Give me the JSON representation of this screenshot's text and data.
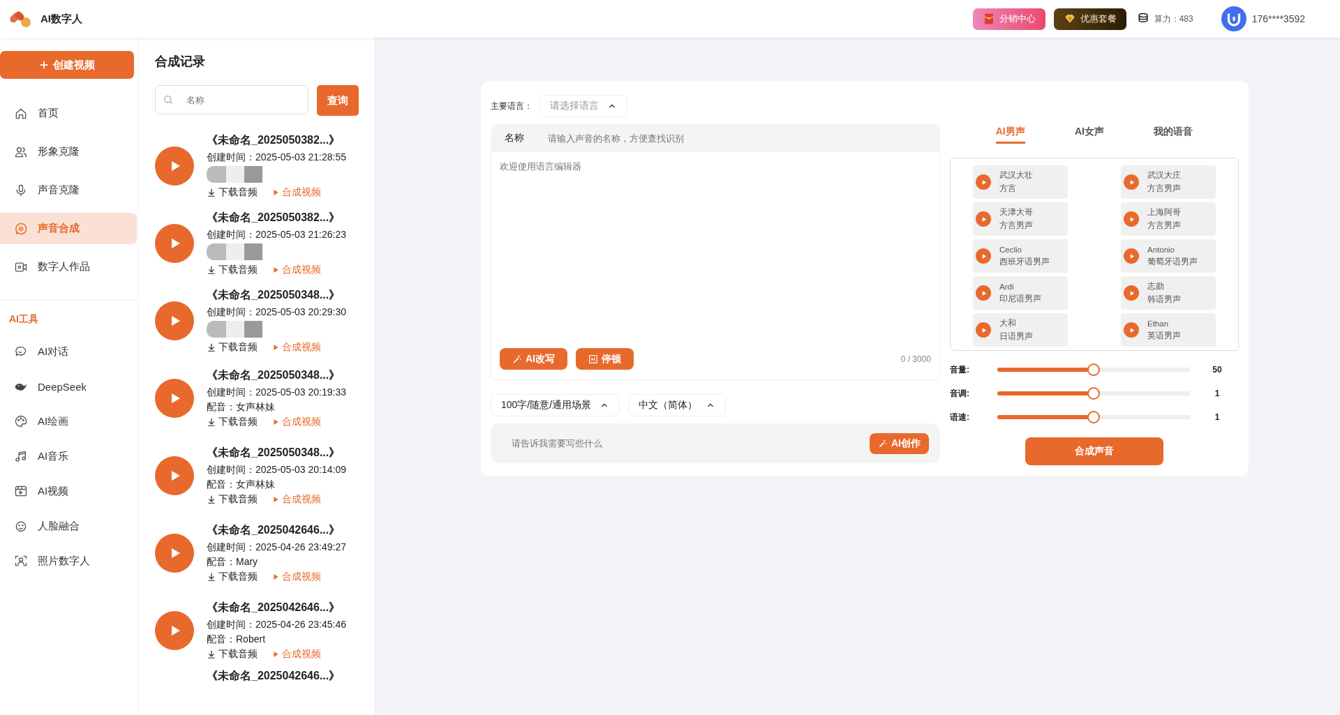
{
  "header": {
    "app_name": "AI数字人",
    "buttons": [
      {
        "kind": "distribution",
        "label": "分销中心"
      },
      {
        "kind": "package",
        "label": "优惠套餐"
      }
    ],
    "credits": "算力：483",
    "user": "176****3592"
  },
  "sidebar": {
    "create_button": "创建视频",
    "items": [
      {
        "kind": "home",
        "label": "首页",
        "selected": false
      },
      {
        "kind": "person",
        "label": "形象克隆",
        "selected": false
      },
      {
        "kind": "mic",
        "label": "声音克隆",
        "selected": false
      },
      {
        "kind": "voice",
        "label": "声音合成",
        "selected": true
      },
      {
        "kind": "video",
        "label": "数字人作品",
        "selected": false
      }
    ],
    "section_title": "AI工具",
    "tools": [
      {
        "kind": "chat",
        "label": "AI对话"
      },
      {
        "kind": "whale",
        "label": "DeepSeek"
      },
      {
        "kind": "palette",
        "label": "AI绘画"
      },
      {
        "kind": "music",
        "label": "AI音乐"
      },
      {
        "kind": "film",
        "label": "AI视频"
      },
      {
        "kind": "face",
        "label": "人脸融合"
      },
      {
        "kind": "photo",
        "label": "照片数字人"
      }
    ]
  },
  "records": {
    "title": "合成记录",
    "search_placeholder": "名称",
    "search_button": "查询",
    "items": [
      {
        "kind": "redacted",
        "title": "《未命名_2025050382...》",
        "created": "创建时间：2025-05-03 21:28:55",
        "download": "下载音频",
        "compose": "合成视频"
      },
      {
        "kind": "redacted",
        "title": "《未命名_2025050382...》",
        "created": "创建时间：2025-05-03 21:26:23",
        "download": "下载音频",
        "compose": "合成视频"
      },
      {
        "kind": "redacted",
        "title": "《未命名_2025050348...》",
        "created": "创建时间：2025-05-03 20:29:30",
        "download": "下载音频",
        "compose": "合成视频"
      },
      {
        "kind": "voiced",
        "title": "《未命名_2025050348...》",
        "created": "创建时间：2025-05-03 20:19:33",
        "voice": "配音：女声林妹",
        "download": "下载音频",
        "compose": "合成视频"
      },
      {
        "kind": "voiced",
        "title": "《未命名_2025050348...》",
        "created": "创建时间：2025-05-03 20:14:09",
        "voice": "配音：女声林妹",
        "download": "下载音频",
        "compose": "合成视频"
      },
      {
        "kind": "voiced",
        "title": "《未命名_2025042646...》",
        "created": "创建时间：2025-04-26 23:49:27",
        "voice": "配音：Mary",
        "download": "下载音频",
        "compose": "合成视频"
      },
      {
        "kind": "voiced",
        "title": "《未命名_2025042646...》",
        "created": "创建时间：2025-04-26 23:45:46",
        "voice": "配音：Robert",
        "download": "下载音频",
        "compose": "合成视频"
      },
      {
        "kind": "title_only",
        "title": "《未命名_2025042646...》"
      }
    ]
  },
  "synth": {
    "language_label": "主要语言：",
    "language_placeholder": "请选择语言",
    "name_label": "名称",
    "name_placeholder": "请输入声音的名称，方便查找识别",
    "editor_placeholder": "欢迎使用语言编辑器",
    "tools": [
      {
        "kind": "rewrite",
        "label": "AI改写"
      },
      {
        "kind": "pause",
        "label": "停顿"
      }
    ],
    "counter": "0 / 3000",
    "selects": [
      "100字/随意/通用场景",
      "中文（简体）"
    ],
    "prompt_placeholder": "请告诉我需要写些什么",
    "create_button": "AI创作",
    "voice_tabs": [
      {
        "label": "AI男声",
        "selected": true
      },
      {
        "label": "AI女声",
        "selected": false
      },
      {
        "label": "我的语音",
        "selected": false
      }
    ],
    "voices": [
      {
        "name": "武汉大壮",
        "desc": "方言"
      },
      {
        "name": "武汉大庄",
        "desc": "方言男声"
      },
      {
        "name": "天津大哥",
        "desc": "方言男声"
      },
      {
        "name": "上海阿哥",
        "desc": "方言男声"
      },
      {
        "name": "Ceclio",
        "desc": "西班牙语男声"
      },
      {
        "name": "Antonio",
        "desc": "葡萄牙语男声"
      },
      {
        "name": "Ardi",
        "desc": "印尼语男声"
      },
      {
        "name": "志勋",
        "desc": "韩语男声"
      },
      {
        "name": "大和",
        "desc": "日语男声"
      },
      {
        "name": "Ethan",
        "desc": "英语男声"
      }
    ],
    "sliders": [
      {
        "label": "音量:",
        "level": 0.5,
        "reading": "50"
      },
      {
        "label": "音调:",
        "level": 0.5,
        "reading": "1"
      },
      {
        "label": "语速:",
        "level": 0.5,
        "reading": "1"
      }
    ],
    "submit": "合成声音"
  }
}
